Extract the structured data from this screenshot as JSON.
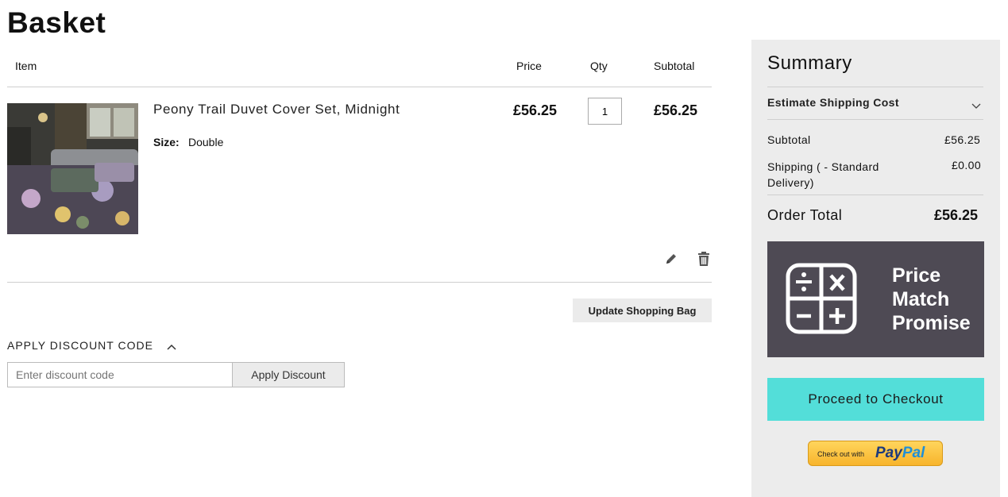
{
  "page": {
    "title": "Basket"
  },
  "table": {
    "headers": {
      "item": "Item",
      "price": "Price",
      "qty": "Qty",
      "subtotal": "Subtotal"
    }
  },
  "item": {
    "name": "Peony Trail Duvet Cover Set, Midnight",
    "size_label": "Size:",
    "size_value": "Double",
    "price": "£56.25",
    "qty": "1",
    "subtotal": "£56.25"
  },
  "actions": {
    "update": "Update Shopping Bag"
  },
  "discount": {
    "title": "APPLY DISCOUNT CODE",
    "placeholder": "Enter discount code",
    "button": "Apply Discount"
  },
  "summary": {
    "title": "Summary",
    "estimate_shipping": "Estimate Shipping Cost",
    "subtotal_label": "Subtotal",
    "subtotal_value": "£56.25",
    "shipping_label": "Shipping ( - Standard Delivery)",
    "shipping_value": "£0.00",
    "order_total_label": "Order Total",
    "order_total_value": "£56.25",
    "promo": {
      "line1": "Price",
      "line2": "Match",
      "line3": "Promise"
    },
    "checkout": "Proceed to Checkout",
    "paypal_prefix": "Check out with",
    "paypal_pay": "Pay",
    "paypal_pal": "Pal"
  },
  "colors": {
    "checkout": "#53ded9",
    "promo_bg": "#4e4a54",
    "summary_bg": "#ececec",
    "paypal": "#f7b42c"
  }
}
